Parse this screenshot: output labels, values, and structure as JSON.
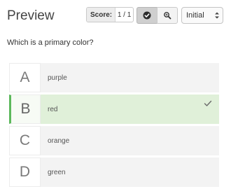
{
  "header": {
    "title": "Preview",
    "score_label": "Score:",
    "score_value": "1 / 1",
    "check_icon": "check-circle-icon",
    "zoom_icon": "magnifier-icon",
    "state_select": {
      "value": "Initial"
    }
  },
  "question": {
    "prompt": "Which is a primary color?"
  },
  "options": [
    {
      "letter": "A",
      "text": "purple",
      "selected": false
    },
    {
      "letter": "B",
      "text": "red",
      "selected": true
    },
    {
      "letter": "C",
      "text": "orange",
      "selected": false
    },
    {
      "letter": "D",
      "text": "green",
      "selected": false
    }
  ],
  "colors": {
    "selected_bg": "#e0f0d9",
    "selected_accent": "#5cb85c",
    "option_bg": "#f3f3f3"
  }
}
